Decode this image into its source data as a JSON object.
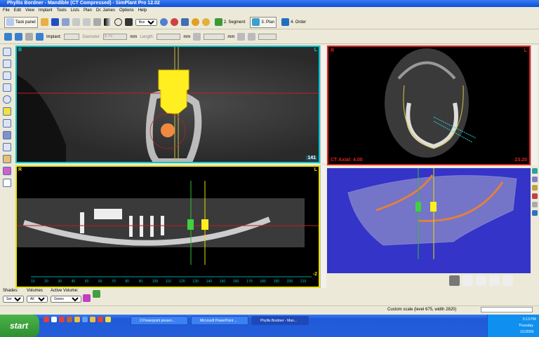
{
  "window": {
    "title": "Phyllis Bordner - Mandible (CT Compressed) - SimPlant Pro  12.02"
  },
  "menu": [
    "File",
    "Edit",
    "View",
    "Implant",
    "Tools",
    "Lists",
    "Plan",
    "Dr. James",
    "Options",
    "Help"
  ],
  "toolbar": {
    "task_panel": "Task panel",
    "zoom_mode": "Box",
    "segment": "2. Segment",
    "plan": "3. Plan",
    "order": "4. Order"
  },
  "implant_bar": {
    "implant_label": "Implant:",
    "diameter_label": "Diameter:",
    "diameter_value": "3.75",
    "mm1": "mm",
    "length_label": "Length:",
    "mm2": "mm",
    "mm3": "mm"
  },
  "views": {
    "cross": {
      "left": "B",
      "right": "L",
      "slice": "141",
      "border": "#00c8d0"
    },
    "axial": {
      "left": "R",
      "right": "L",
      "caption": "CT Axial: 4.00",
      "value": "23.20",
      "border": "#e02020"
    },
    "pano": {
      "left": "R",
      "right": "L",
      "corner": "-2",
      "border": "#e8e000",
      "ruler": [
        "10",
        "20",
        "30",
        "40",
        "50",
        "60",
        "70",
        "80",
        "90",
        "100",
        "110",
        "120",
        "130",
        "140",
        "150",
        "160",
        "170",
        "180",
        "190",
        "200",
        "210"
      ]
    },
    "threeD": {
      "bg": "#3434c8"
    }
  },
  "bottom_controls": {
    "shades_label": "Shades:",
    "shades_value": "Semi",
    "volumes_label": "Volumes",
    "volumes_value": "All",
    "active_label": "Active Volume:",
    "active_value": "Green"
  },
  "status": {
    "text": "Custom scale (level 675, width 2820)"
  },
  "taskbar": {
    "start": "start",
    "tasks": [
      "2.Powerpoint presen...",
      "Microsoft PowerPoint ...",
      "Phyllis Bordner - Man..."
    ],
    "time": "5:13 PM",
    "day": "Thursday",
    "date": "1/1/2003"
  }
}
